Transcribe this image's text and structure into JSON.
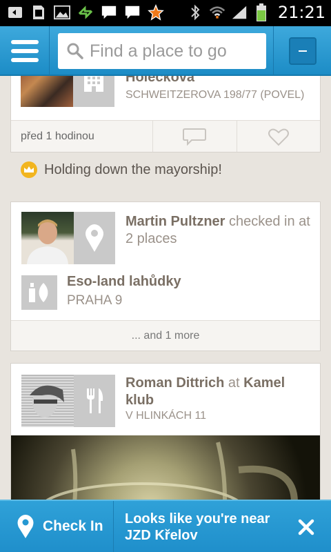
{
  "status_bar": {
    "time": "21:21",
    "icons": [
      "back-icon",
      "sd-card-icon",
      "gallery-icon",
      "sync-icon",
      "chat-icon",
      "chat-icon",
      "star-icon",
      "bluetooth-icon",
      "wifi-icon",
      "signal-icon",
      "battery-icon"
    ]
  },
  "header": {
    "search_placeholder": "Find a place to go",
    "menu_icon": "hamburger-icon"
  },
  "feed": {
    "card1": {
      "venue_name": "Holečkova",
      "address": "SCHWEITZEROVA 198/77 (POVEL)",
      "time": "před 1 hodinou",
      "category_icon": "building-icon"
    },
    "mayor_notice": "Holding down the mayorship!",
    "card2": {
      "user": "Martin Pultzner",
      "action": " checked in at 2 places",
      "venue_name": "Eso-land lahůdky",
      "venue_city": "PRAHA 9",
      "more": "... and 1 more",
      "category_icon": "map-pin-icon",
      "venue_icon": "bottle-fish-icon"
    },
    "card3": {
      "user": "Roman Dittrich",
      "at": " at ",
      "venue_name": "Kamel klub",
      "address": "V HLINKÁCH 11",
      "category_icon": "fork-knife-icon"
    }
  },
  "bottom_bar": {
    "checkin_label": "Check In",
    "message": "Looks like you're near JZD Křelov"
  },
  "colors": {
    "accent": "#2196d3",
    "background": "#e8e4de",
    "title": "#7a6f64"
  }
}
